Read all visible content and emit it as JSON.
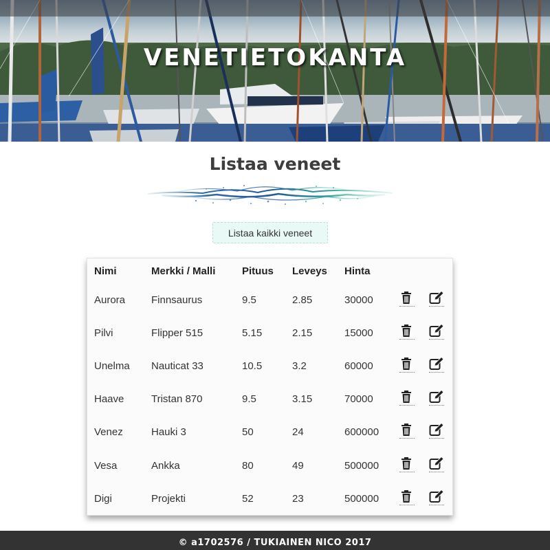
{
  "hero": {
    "title": "VENETIETOKANTA"
  },
  "page": {
    "heading": "Listaa veneet"
  },
  "list_button": {
    "label": "Listaa kaikki veneet"
  },
  "table": {
    "headers": {
      "name": "Nimi",
      "brand": "Merkki / Malli",
      "length": "Pituus",
      "width": "Leveys",
      "price": "Hinta"
    },
    "rows": [
      {
        "name": "Aurora",
        "brand": "Finnsaurus",
        "length": "9.5",
        "width": "2.85",
        "price": "30000"
      },
      {
        "name": "Pilvi",
        "brand": "Flipper 515",
        "length": "5.15",
        "width": "2.15",
        "price": "15000"
      },
      {
        "name": "Unelma",
        "brand": "Nauticat 33",
        "length": "10.5",
        "width": "3.2",
        "price": "60000"
      },
      {
        "name": "Haave",
        "brand": "Tristan 870",
        "length": "9.5",
        "width": "3.15",
        "price": "70000"
      },
      {
        "name": "Venez",
        "brand": "Hauki 3",
        "length": "50",
        "width": "24",
        "price": "600000"
      },
      {
        "name": "Vesa",
        "brand": "Ankka",
        "length": "80",
        "width": "49",
        "price": "500000"
      },
      {
        "name": "Digi",
        "brand": "Projekti",
        "length": "52",
        "width": "23",
        "price": "500000"
      }
    ],
    "row_icons": [
      "trash-icon",
      "edit-icon"
    ]
  },
  "footer": {
    "text": "© a1702576 / TUKIAINEN NICO 2017"
  },
  "colors": {
    "footer_bg": "#333333",
    "button_bg": "#e9f9f5",
    "heading_text": "#3d3d3d"
  }
}
